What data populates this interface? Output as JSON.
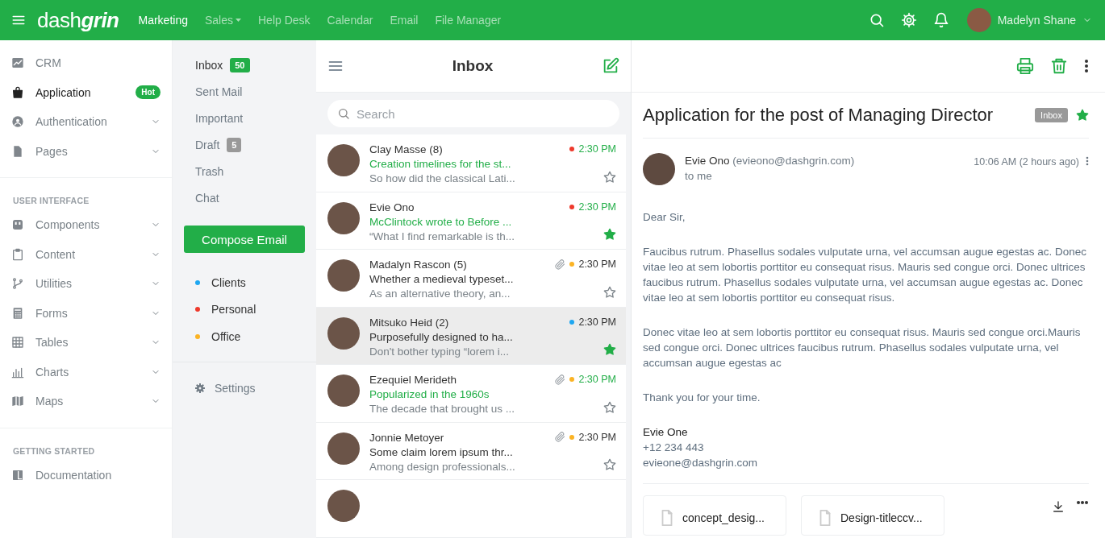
{
  "topbar": {
    "brand": "dash**grin**",
    "nav": [
      {
        "label": "Marketing",
        "selected": true,
        "dropdown": false
      },
      {
        "label": "Sales",
        "selected": false,
        "dropdown": true
      },
      {
        "label": "Help Desk",
        "selected": false,
        "dropdown": false
      },
      {
        "label": "Calendar",
        "selected": false,
        "dropdown": false
      },
      {
        "label": "Email",
        "selected": false,
        "dropdown": false
      },
      {
        "label": "File Manager",
        "selected": false,
        "dropdown": false
      }
    ],
    "user": {
      "name": "Madelyn Shane"
    }
  },
  "sidebar": {
    "sections": [
      {
        "items": [
          {
            "label": "CRM",
            "selected": false,
            "expandable": false
          },
          {
            "label": "Application",
            "selected": true,
            "expandable": false,
            "badge": "Hot"
          },
          {
            "label": "Authentication",
            "selected": false,
            "expandable": true
          },
          {
            "label": "Pages",
            "selected": false,
            "expandable": true
          }
        ]
      },
      {
        "heading": "USER INTERFACE",
        "items": [
          {
            "label": "Components",
            "selected": false,
            "expandable": true
          },
          {
            "label": "Content",
            "selected": false,
            "expandable": true
          },
          {
            "label": "Utilities",
            "selected": false,
            "expandable": true
          },
          {
            "label": "Forms",
            "selected": false,
            "expandable": true
          },
          {
            "label": "Tables",
            "selected": false,
            "expandable": true
          },
          {
            "label": "Charts",
            "selected": false,
            "expandable": true
          },
          {
            "label": "Maps",
            "selected": false,
            "expandable": true
          }
        ]
      },
      {
        "heading": "GETTING STARTED",
        "items": [
          {
            "label": "Documentation",
            "selected": false,
            "expandable": false
          }
        ]
      }
    ]
  },
  "folders": {
    "items": [
      {
        "label": "Inbox",
        "selected": true,
        "count": "50",
        "color": "#22ae48"
      },
      {
        "label": "Sent Mail",
        "selected": false
      },
      {
        "label": "Important",
        "selected": false
      },
      {
        "label": "Draft",
        "selected": false,
        "count": "5",
        "color": "#999999"
      },
      {
        "label": "Trash",
        "selected": false
      },
      {
        "label": "Chat",
        "selected": false
      }
    ],
    "compose": "Compose Email",
    "labels": [
      {
        "label": "Clients",
        "color": "#1ea7f1"
      },
      {
        "label": "Personal",
        "color": "#ee3a2c"
      },
      {
        "label": "Office",
        "color": "#fbb324"
      }
    ],
    "settings": "Settings"
  },
  "inbox": {
    "title": "Inbox",
    "search": {
      "placeholder": "Search"
    },
    "emails": [
      {
        "sender": "Clay Masse (8)",
        "subject": "Creation timelines for the st...",
        "preview": "So how did the classical Lati...",
        "time": "2:30 PM",
        "color": "#ee3a2c",
        "unread": true,
        "attachment": false,
        "starred": false,
        "selected": false
      },
      {
        "sender": "Evie Ono",
        "subject": "McClintock wrote to Before ...",
        "preview": "“What I find remarkable is th...",
        "time": "2:30 PM",
        "color": "#ee3a2c",
        "unread": true,
        "attachment": false,
        "starred": true,
        "selected": false
      },
      {
        "sender": "Madalyn Rascon (5)",
        "subject": "Whether a medieval typeset...",
        "preview": "As an alternative theory, an...",
        "time": "2:30 PM",
        "color": "#fbb324",
        "unread": false,
        "attachment": true,
        "starred": false,
        "selected": false
      },
      {
        "sender": "Mitsuko Heid (2)",
        "subject": "Purposefully designed to ha...",
        "preview": "Don't bother typing “lorem i...",
        "time": "2:30 PM",
        "color": "#1ea7f1",
        "unread": false,
        "attachment": false,
        "starred": true,
        "selected": true
      },
      {
        "sender": "Ezequiel Merideth",
        "subject": "Popularized in the 1960s",
        "preview": "The decade that brought us ...",
        "time": "2:30 PM",
        "color": "#fbb324",
        "unread": true,
        "attachment": true,
        "starred": false,
        "selected": false
      },
      {
        "sender": "Jonnie Metoyer",
        "subject": "Some claim lorem ipsum thr...",
        "preview": "Among design professionals...",
        "time": "2:30 PM",
        "color": "#fbb324",
        "unread": false,
        "attachment": true,
        "starred": false,
        "selected": false
      }
    ]
  },
  "message": {
    "subject": "Application for the post of Managing Director",
    "badge": "Inbox",
    "starred": true,
    "from_name": "Evie Ono",
    "from_email": "(evieono@dashgrin.com)",
    "to": "to me",
    "time": "10:06 AM (2 hours ago)",
    "greeting": "Dear Sir,",
    "paragraphs": [
      "Faucibus rutrum. Phasellus sodales vulputate urna, vel accumsan augue egestas ac. Donec vitae leo at sem lobortis porttitor eu consequat risus. Mauris sed congue orci. Donec ultrices faucibus rutrum. Phasellus sodales vulputate urna, vel accumsan augue egestas ac. Donec vitae leo at sem lobortis porttitor eu consequat risus.",
      "Donec vitae leo at sem lobortis porttitor eu consequat risus. Mauris sed congue orci.Mauris sed congue orci. Donec ultrices faucibus rutrum. Phasellus sodales vulputate urna, vel accumsan augue egestas ac"
    ],
    "closing": "Thank you for your time.",
    "signature": [
      "Evie One",
      "+12 234 443",
      "evieone@dashgrin.com"
    ],
    "attachments": [
      "concept_desig...",
      "Design-titleccv..."
    ]
  }
}
